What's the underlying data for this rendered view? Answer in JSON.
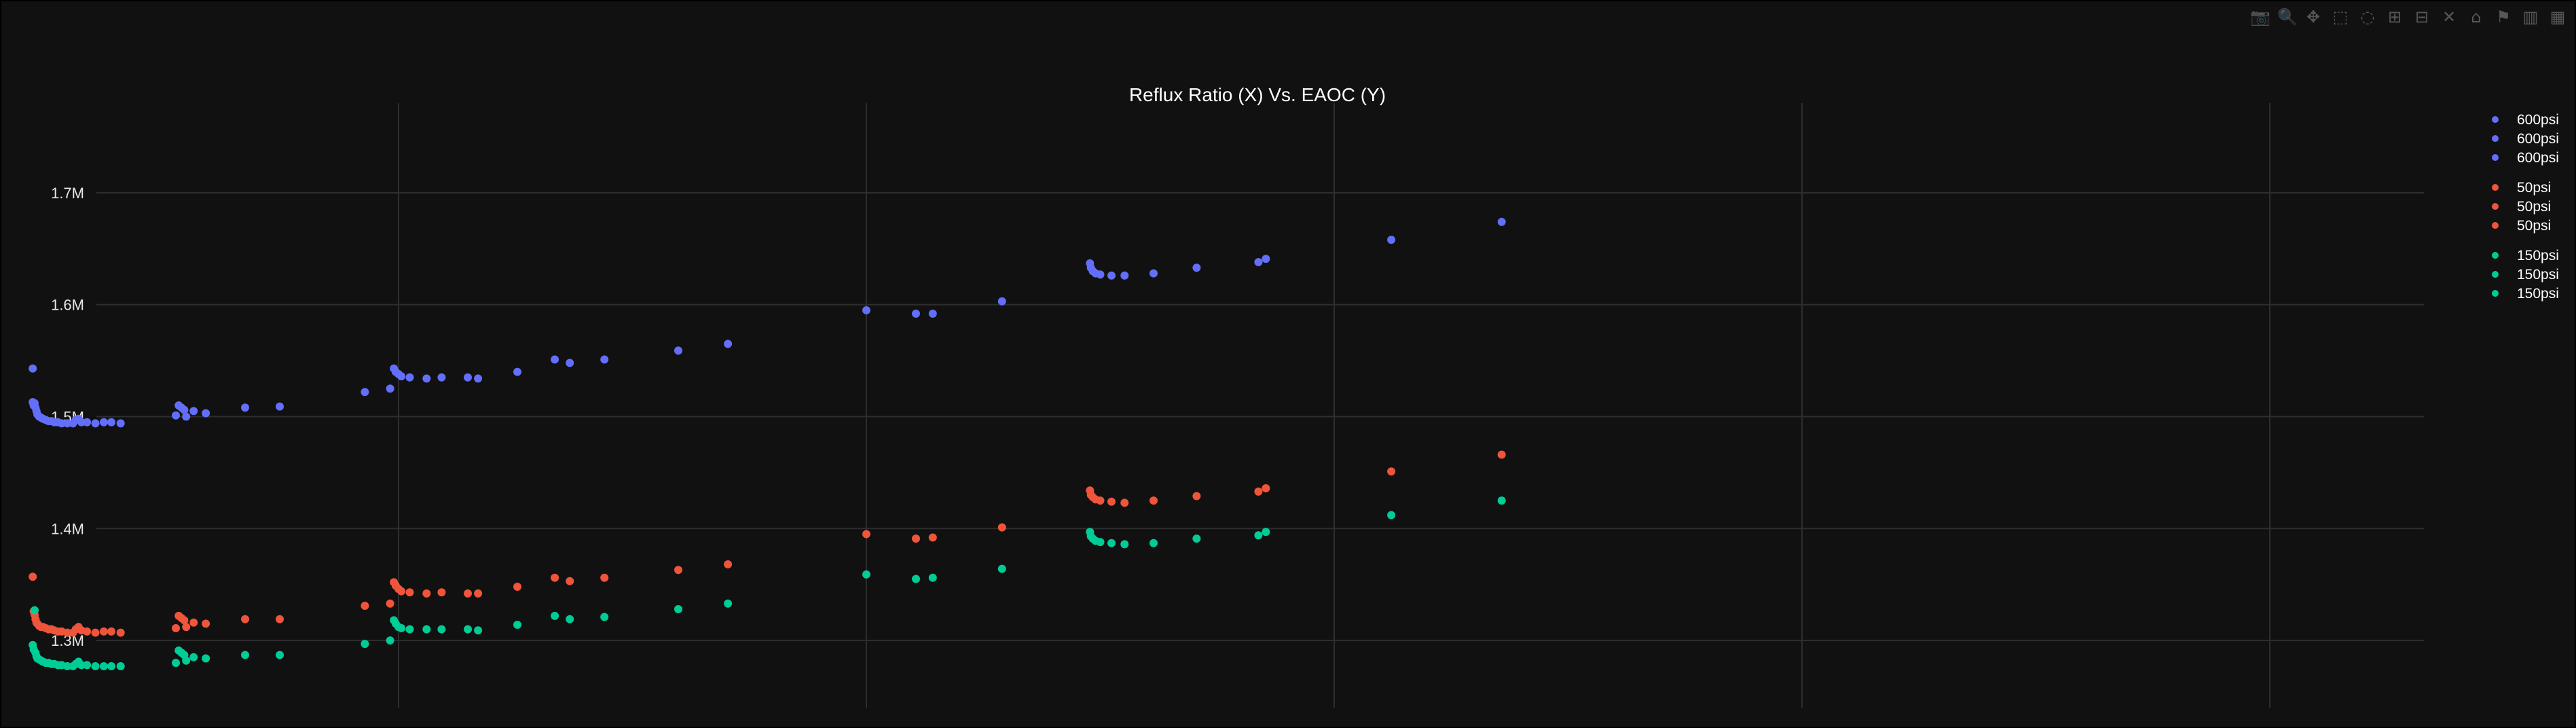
{
  "modebar": {
    "icons": [
      "camera-icon",
      "zoom-icon",
      "pan-icon",
      "box-select-icon",
      "lasso-icon",
      "zoom-in-icon",
      "zoom-out-icon",
      "autoscale-icon",
      "reset-axes-icon",
      "spike-lines-icon",
      "hover-closest-icon",
      "hover-compare-icon"
    ],
    "glyphs": [
      "📷",
      "🔍",
      "✥",
      "⬚",
      "◌",
      "⊞",
      "⊟",
      "✕",
      "⌂",
      "⚑",
      "▥",
      "▦"
    ]
  },
  "chart_data": {
    "type": "scatter",
    "title": "Reflux Ratio (X) Vs. EAOC (Y)",
    "xlabel": "",
    "ylabel": "",
    "xlim": [
      1.08,
      2.32
    ],
    "ylim": [
      1240000,
      1780000
    ],
    "x_gridlines": [
      1.5,
      2.0,
      2.5,
      3.0,
      3.5
    ],
    "y_ticks": [
      {
        "value": 1300000,
        "label": "1.3M"
      },
      {
        "value": 1400000,
        "label": "1.4M"
      },
      {
        "value": 1500000,
        "label": "1.5M"
      },
      {
        "value": 1600000,
        "label": "1.6M"
      },
      {
        "value": 1700000,
        "label": "1.7M"
      }
    ],
    "legend_position": "top-right",
    "x_ticks_shown": false,
    "series": [
      {
        "name": "600psi",
        "color": "#636efa",
        "legend_entries": 3,
        "points": [
          [
            1.109,
            1543000
          ],
          [
            1.109,
            1513000
          ],
          [
            1.11,
            1510000
          ],
          [
            1.111,
            1512000
          ],
          [
            1.112,
            1508000
          ],
          [
            1.113,
            1505000
          ],
          [
            1.114,
            1502000
          ],
          [
            1.116,
            1500000
          ],
          [
            1.118,
            1499000
          ],
          [
            1.12,
            1498000
          ],
          [
            1.123,
            1497000
          ],
          [
            1.126,
            1496000
          ],
          [
            1.129,
            1496000
          ],
          [
            1.132,
            1495000
          ],
          [
            1.136,
            1495000
          ],
          [
            1.14,
            1494000
          ],
          [
            1.146,
            1494000
          ],
          [
            1.152,
            1494000
          ],
          [
            1.155,
            1497000
          ],
          [
            1.158,
            1498000
          ],
          [
            1.161,
            1495000
          ],
          [
            1.167,
            1495000
          ],
          [
            1.176,
            1494000
          ],
          [
            1.185,
            1495000
          ],
          [
            1.193,
            1495000
          ],
          [
            1.203,
            1494000
          ],
          [
            1.262,
            1501000
          ],
          [
            1.265,
            1510000
          ],
          [
            1.268,
            1508000
          ],
          [
            1.271,
            1506000
          ],
          [
            1.273,
            1500000
          ],
          [
            1.281,
            1505000
          ],
          [
            1.294,
            1503000
          ],
          [
            1.336,
            1508000
          ],
          [
            1.373,
            1509000
          ],
          [
            1.464,
            1522000
          ],
          [
            1.491,
            1525000
          ],
          [
            1.495,
            1543000
          ],
          [
            1.497,
            1540000
          ],
          [
            1.5,
            1538000
          ],
          [
            1.503,
            1536000
          ],
          [
            1.512,
            1535000
          ],
          [
            1.53,
            1534000
          ],
          [
            1.546,
            1535000
          ],
          [
            1.574,
            1535000
          ],
          [
            1.585,
            1534000
          ],
          [
            1.627,
            1540000
          ],
          [
            1.667,
            1551000
          ],
          [
            1.683,
            1548000
          ],
          [
            1.72,
            1551000
          ],
          [
            1.799,
            1559000
          ],
          [
            1.852,
            1565000
          ],
          [
            2.0,
            1595000
          ],
          [
            2.053,
            1592000
          ],
          [
            2.071,
            1592000
          ],
          [
            2.145,
            1603000
          ],
          [
            2.239,
            1637000
          ],
          [
            2.24,
            1633000
          ],
          [
            2.242,
            1630000
          ],
          [
            2.245,
            1628000
          ],
          [
            2.25,
            1627000
          ],
          [
            2.262,
            1626000
          ],
          [
            2.276,
            1626000
          ],
          [
            2.307,
            1628000
          ],
          [
            2.353,
            1633000
          ],
          [
            2.419,
            1638000
          ],
          [
            2.427,
            1641000
          ],
          [
            2.561,
            1658000
          ],
          [
            2.679,
            1674000
          ]
        ]
      },
      {
        "name": "50psi",
        "color": "#ef553b",
        "legend_entries": 3,
        "points": [
          [
            1.109,
            1357000
          ],
          [
            1.11,
            1326000
          ],
          [
            1.111,
            1323000
          ],
          [
            1.112,
            1319000
          ],
          [
            1.113,
            1316000
          ],
          [
            1.114,
            1315000
          ],
          [
            1.116,
            1313000
          ],
          [
            1.118,
            1312000
          ],
          [
            1.12,
            1312000
          ],
          [
            1.123,
            1311000
          ],
          [
            1.126,
            1310000
          ],
          [
            1.129,
            1310000
          ],
          [
            1.132,
            1309000
          ],
          [
            1.136,
            1308000
          ],
          [
            1.14,
            1308000
          ],
          [
            1.146,
            1307000
          ],
          [
            1.152,
            1307000
          ],
          [
            1.155,
            1310000
          ],
          [
            1.158,
            1312000
          ],
          [
            1.161,
            1309000
          ],
          [
            1.167,
            1308000
          ],
          [
            1.176,
            1307000
          ],
          [
            1.185,
            1308000
          ],
          [
            1.193,
            1308000
          ],
          [
            1.203,
            1307000
          ],
          [
            1.262,
            1311000
          ],
          [
            1.265,
            1322000
          ],
          [
            1.268,
            1320000
          ],
          [
            1.271,
            1318000
          ],
          [
            1.273,
            1312000
          ],
          [
            1.281,
            1316000
          ],
          [
            1.294,
            1315000
          ],
          [
            1.336,
            1319000
          ],
          [
            1.373,
            1319000
          ],
          [
            1.464,
            1331000
          ],
          [
            1.491,
            1333000
          ],
          [
            1.495,
            1352000
          ],
          [
            1.497,
            1349000
          ],
          [
            1.5,
            1346000
          ],
          [
            1.503,
            1344000
          ],
          [
            1.512,
            1343000
          ],
          [
            1.53,
            1342000
          ],
          [
            1.546,
            1343000
          ],
          [
            1.574,
            1342000
          ],
          [
            1.585,
            1342000
          ],
          [
            1.627,
            1348000
          ],
          [
            1.667,
            1356000
          ],
          [
            1.683,
            1353000
          ],
          [
            1.72,
            1356000
          ],
          [
            1.799,
            1363000
          ],
          [
            1.852,
            1368000
          ],
          [
            2.0,
            1395000
          ],
          [
            2.053,
            1391000
          ],
          [
            2.071,
            1392000
          ],
          [
            2.145,
            1401000
          ],
          [
            2.239,
            1434000
          ],
          [
            2.24,
            1430000
          ],
          [
            2.242,
            1428000
          ],
          [
            2.245,
            1426000
          ],
          [
            2.25,
            1425000
          ],
          [
            2.262,
            1424000
          ],
          [
            2.276,
            1423000
          ],
          [
            2.307,
            1425000
          ],
          [
            2.353,
            1429000
          ],
          [
            2.419,
            1433000
          ],
          [
            2.427,
            1436000
          ],
          [
            2.561,
            1451000
          ],
          [
            2.679,
            1466000
          ]
        ]
      },
      {
        "name": "150psi",
        "color": "#00cc96",
        "legend_entries": 3,
        "points": [
          [
            1.109,
            1296000
          ],
          [
            1.11,
            1292000
          ],
          [
            1.111,
            1327000
          ],
          [
            1.112,
            1289000
          ],
          [
            1.113,
            1286000
          ],
          [
            1.114,
            1284000
          ],
          [
            1.116,
            1283000
          ],
          [
            1.118,
            1282000
          ],
          [
            1.12,
            1281000
          ],
          [
            1.123,
            1280000
          ],
          [
            1.126,
            1280000
          ],
          [
            1.129,
            1279000
          ],
          [
            1.132,
            1279000
          ],
          [
            1.136,
            1278000
          ],
          [
            1.14,
            1278000
          ],
          [
            1.146,
            1277000
          ],
          [
            1.152,
            1277000
          ],
          [
            1.155,
            1279000
          ],
          [
            1.158,
            1281000
          ],
          [
            1.161,
            1278000
          ],
          [
            1.167,
            1278000
          ],
          [
            1.176,
            1277000
          ],
          [
            1.185,
            1277000
          ],
          [
            1.193,
            1277000
          ],
          [
            1.203,
            1277000
          ],
          [
            1.262,
            1280000
          ],
          [
            1.265,
            1291000
          ],
          [
            1.268,
            1289000
          ],
          [
            1.271,
            1287000
          ],
          [
            1.273,
            1282000
          ],
          [
            1.281,
            1285000
          ],
          [
            1.294,
            1284000
          ],
          [
            1.336,
            1287000
          ],
          [
            1.373,
            1287000
          ],
          [
            1.464,
            1297000
          ],
          [
            1.491,
            1300000
          ],
          [
            1.495,
            1318000
          ],
          [
            1.497,
            1315000
          ],
          [
            1.5,
            1312000
          ],
          [
            1.503,
            1311000
          ],
          [
            1.512,
            1310000
          ],
          [
            1.53,
            1310000
          ],
          [
            1.546,
            1310000
          ],
          [
            1.574,
            1310000
          ],
          [
            1.585,
            1309000
          ],
          [
            1.627,
            1314000
          ],
          [
            1.667,
            1322000
          ],
          [
            1.683,
            1319000
          ],
          [
            1.72,
            1321000
          ],
          [
            1.799,
            1328000
          ],
          [
            1.852,
            1333000
          ],
          [
            2.0,
            1359000
          ],
          [
            2.053,
            1355000
          ],
          [
            2.071,
            1356000
          ],
          [
            2.145,
            1364000
          ],
          [
            2.239,
            1397000
          ],
          [
            2.24,
            1393000
          ],
          [
            2.242,
            1391000
          ],
          [
            2.245,
            1389000
          ],
          [
            2.25,
            1388000
          ],
          [
            2.262,
            1387000
          ],
          [
            2.276,
            1386000
          ],
          [
            2.307,
            1387000
          ],
          [
            2.353,
            1391000
          ],
          [
            2.419,
            1394000
          ],
          [
            2.427,
            1397000
          ],
          [
            2.561,
            1412000
          ],
          [
            2.679,
            1425000
          ]
        ]
      }
    ]
  }
}
